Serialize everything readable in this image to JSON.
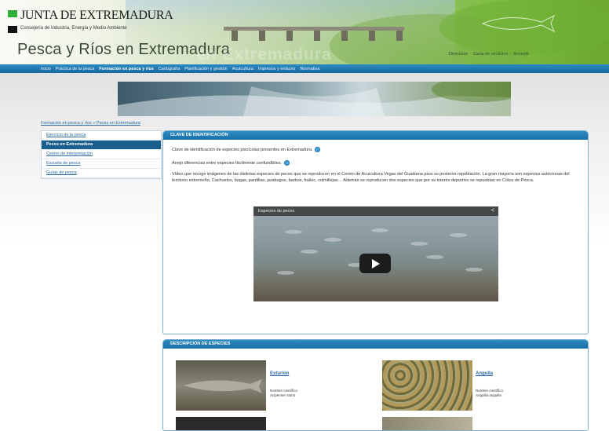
{
  "header": {
    "org": "JUNTA DE EXTREMADURA",
    "department": "Consejería de Industria, Energía y Medio Ambiente",
    "site_title": "Pesca y Ríos en Extremadura",
    "ghost_title": "en Extremadura",
    "top_links": [
      "Directorio",
      "Carta de servicios",
      "Accesib"
    ]
  },
  "nav": {
    "items": [
      "Inicio",
      "Práctica de la pesca",
      "Formación en pesca y ríos",
      "Cartografía",
      "Planificación y gestión",
      "Acuicultura",
      "Impresos y enlaces",
      "Normativa"
    ]
  },
  "breadcrumb": "Formación en pesca y ríos » Peces en Extremadura",
  "sidebar": {
    "items": [
      "Ejercicio de la pesca",
      "Peces en Extremadura",
      "Centro de interpretación",
      "Escuela de pesca",
      "Guías de pesca"
    ]
  },
  "clave": {
    "header": "CLAVE DE IDENTIFICACIÓN",
    "line1": "Clave de identificación de especies piscícolas presentes en Extremadura.",
    "line2": "Anejo diferencias entre especies fácilmente confundibles.",
    "para": "Vídeo que recoge imágenes de las distintas especies de peces que se reproducen en el Centro de Acuicultura Vegas del Guadiana para su posterior repoblación. La gran mayoría son especies autóctonas del territorio extremeño. Cachuelos, bogas, pardillas, jarabugos, barbos, fraileс, colmillejas… Además se reproducen dos especies que por su interés deportivo se repueblan en Cotos de Pesca."
  },
  "video": {
    "title": "Especies de peces"
  },
  "especies": {
    "header": "DESCRIPCIÓN DE ESPECIES",
    "items": [
      {
        "name": "Esturión",
        "label": "Nombre científico",
        "scientific": "Acipenser sturio"
      },
      {
        "name": "Anguila",
        "label": "Nombre científico",
        "scientific": "Anguilla anguilla"
      }
    ]
  },
  "colors": {
    "nav_blue": "#1a6ea6",
    "active_blue": "#1a5f8e",
    "link_blue": "#2a6aa8",
    "green": "#2fae3c"
  }
}
